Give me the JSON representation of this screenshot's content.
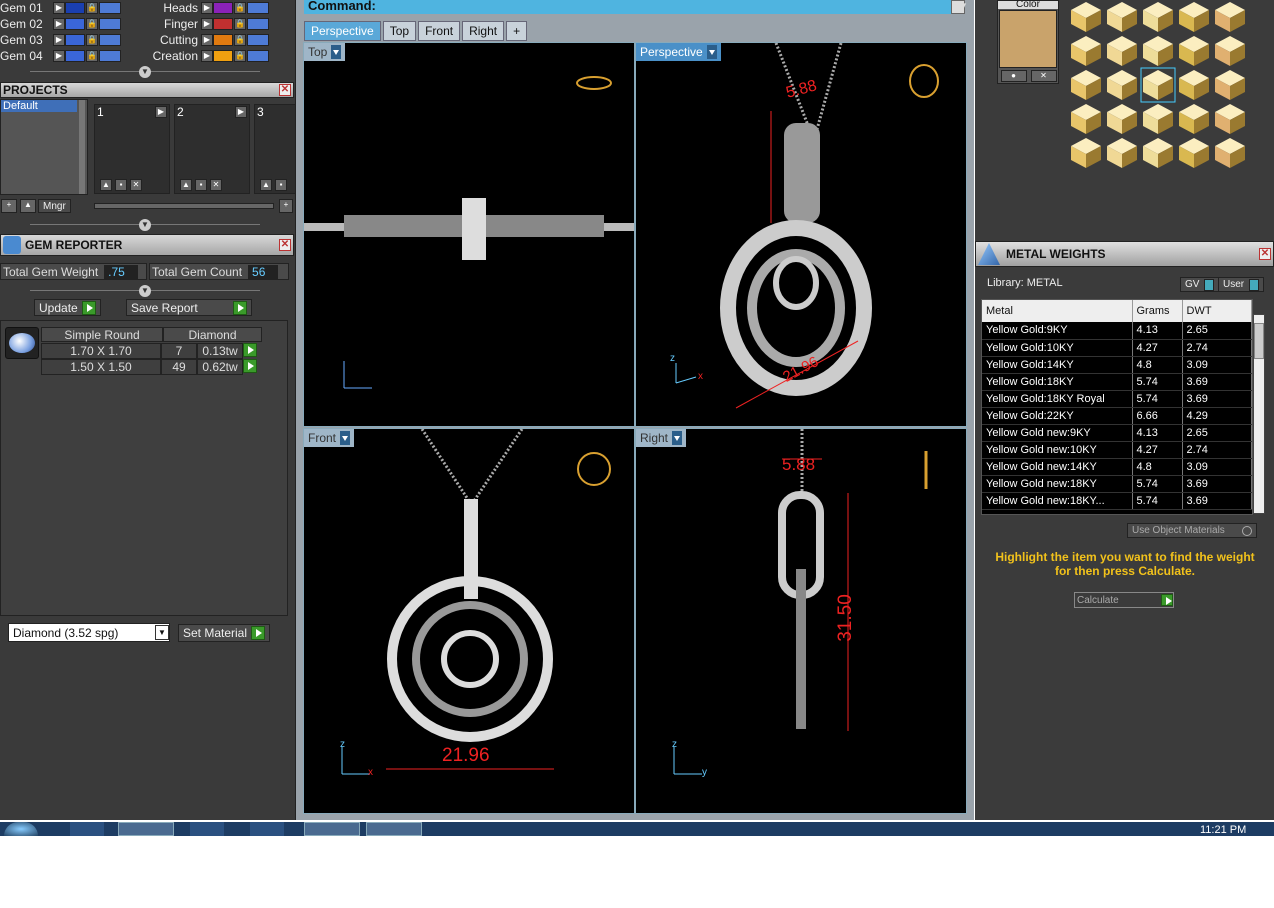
{
  "layers": [
    {
      "name": "Gem 01",
      "color": "#1a3fb0"
    },
    {
      "name": "Gem 02",
      "color": "#3a66d8"
    },
    {
      "name": "Gem 03",
      "color": "#3a66d8"
    },
    {
      "name": "Gem 04",
      "color": "#3a66d8"
    }
  ],
  "layers2": [
    {
      "name": "Heads",
      "color": "#8a22b8"
    },
    {
      "name": "Finger",
      "color": "#c03030"
    },
    {
      "name": "Cutting",
      "color": "#e07a10"
    },
    {
      "name": "Creation",
      "color": "#f0a010"
    }
  ],
  "projects": {
    "title": "PROJECTS",
    "list": [
      "Default"
    ],
    "slots": [
      "1",
      "2",
      "3"
    ],
    "mngr": "Mngr"
  },
  "gem_reporter": {
    "title": "GEM REPORTER",
    "weight_label": "Total Gem Weight",
    "weight_value": ".75",
    "count_label": "Total Gem Count",
    "count_value": "56",
    "update": "Update",
    "save_report": "Save Report",
    "shape": "Simple Round",
    "material": "Diamond",
    "rows": [
      {
        "size": "1.70 X 1.70",
        "count": "7",
        "tw": "0.13tw"
      },
      {
        "size": "1.50 X 1.50",
        "count": "49",
        "tw": "0.62tw"
      }
    ],
    "material_select": "Diamond    (3.52 spg)",
    "set_material": "Set Material"
  },
  "command": {
    "label": "Command:"
  },
  "tabs": [
    "Perspective",
    "Top",
    "Front",
    "Right",
    "+"
  ],
  "viewports": {
    "top": "Top",
    "perspective": "Perspective",
    "front": "Front",
    "right": "Right",
    "dims": {
      "a": "5.88",
      "b": "21.96",
      "c": "31.50",
      "d": "21.96",
      "e": "5.88"
    }
  },
  "color_panel": {
    "label": "Color",
    "swatch": "#c9a36b"
  },
  "metal_weights": {
    "title": "METAL WEIGHTS",
    "library": "Library: METAL",
    "gv": "GV",
    "user": "User",
    "headers": [
      "Metal",
      "Grams",
      "DWT"
    ],
    "rows": [
      [
        "Yellow Gold:9KY",
        "4.13",
        "2.65"
      ],
      [
        "Yellow Gold:10KY",
        "4.27",
        "2.74"
      ],
      [
        "Yellow Gold:14KY",
        "4.8",
        "3.09"
      ],
      [
        "Yellow Gold:18KY",
        "5.74",
        "3.69"
      ],
      [
        "Yellow Gold:18KY Royal",
        "5.74",
        "3.69"
      ],
      [
        "Yellow Gold:22KY",
        "6.66",
        "4.29"
      ],
      [
        "Yellow Gold new:9KY",
        "4.13",
        "2.65"
      ],
      [
        "Yellow Gold new:10KY",
        "4.27",
        "2.74"
      ],
      [
        "Yellow Gold new:14KY",
        "4.8",
        "3.09"
      ],
      [
        "Yellow Gold new:18KY",
        "5.74",
        "3.69"
      ],
      [
        "Yellow Gold new:18KY...",
        "5.74",
        "3.69"
      ]
    ],
    "use_object": "Use Object Materials",
    "hint": "Highlight the item you want to find the weight for then press Calculate.",
    "calculate": "Calculate"
  },
  "clock": "11:21 PM"
}
